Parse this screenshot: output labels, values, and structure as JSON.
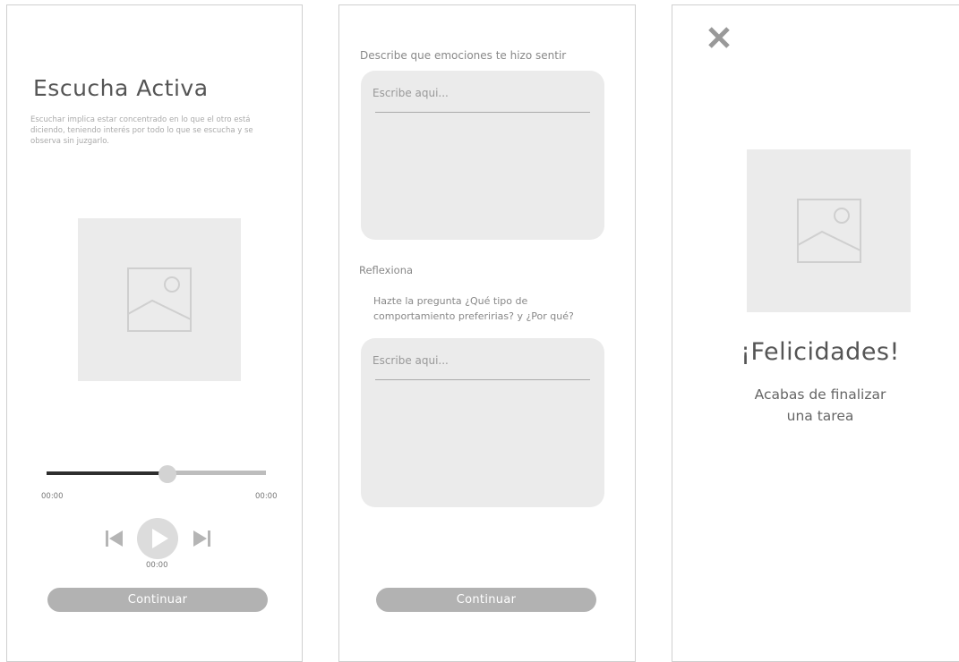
{
  "screen1": {
    "title": "Escucha Activa",
    "description": "Escuchar implica estar concentrado en lo que el otro está diciendo, teniendo interés por todo lo que se escucha y se observa sin juzgarlo.",
    "player": {
      "progress": 0.55,
      "time_start": "00:00",
      "time_end": "00:00",
      "time_current": "00:00"
    },
    "continue_label": "Continuar"
  },
  "screen2": {
    "question1": "Describe que emociones te hizo sentir",
    "input1_placeholder": "Escribe aqui...",
    "reflect_heading": "Reflexiona",
    "reflect_prompt": "Hazte la pregunta ¿Qué tipo de comportamiento preferirias? y ¿Por qué?",
    "input2_placeholder": "Escribe aqui...",
    "continue_label": "Continuar"
  },
  "screen3": {
    "title": "¡Felicidades!",
    "subtitle": "Acabas de finalizar una tarea"
  },
  "icons": {
    "image_placeholder": "image-icon",
    "play": "play-icon",
    "previous": "skip-previous-icon",
    "next": "skip-next-icon",
    "close": "close-icon"
  },
  "colors": {
    "button": "#b2b2b2",
    "placeholder_fill": "#ebebeb",
    "track_played": "#2e2e2e",
    "track_rest": "#bdbdbd"
  }
}
